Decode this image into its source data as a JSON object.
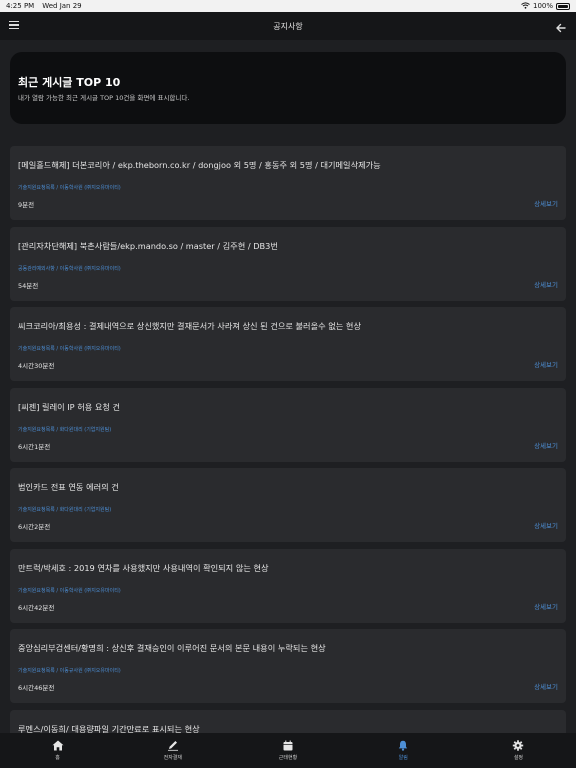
{
  "status_bar": {
    "time": "4:25 PM",
    "date": "Wed Jan 29",
    "battery": "100%"
  },
  "nav": {
    "title": "공지사항"
  },
  "banner": {
    "title": "최근 게시글 TOP 10",
    "subtitle": "내가 열람 가능한 최근 게시글 TOP 10건을 화면에 표시합니다."
  },
  "detail_label": "상세보기",
  "posts": [
    {
      "title": "[메일홀드해제] 더본코리아 / ekp.theborn.co.kr / dongjoo 외 5명 / 홍동주 외 5명 / 대기메일삭제가능",
      "category": "기술지원요청목록 / 이동학사원 (㈜지오유마이티)",
      "time": "9분전"
    },
    {
      "title": "[관리자차단해제] 북촌사람들/ekp.mando.so / master / 김주현 / DB3번",
      "category": "공동관리예외사항 / 이동학사원 (㈜지오유마이티)",
      "time": "54분전"
    },
    {
      "title": "씨크코리아/최용성 : 결제내역으로 상신했지만 결재문서가 사라져 상신 된 건으로 불러올수 없는 현상",
      "category": "기술지원요청목록 / 이동학사원 (㈜지오유마이티)",
      "time": "4시간30분전"
    },
    {
      "title": "[씨젠] 릴레이 IP 허용 요청 건",
      "category": "기술지원요청목록 / 화다윈대리 (기업지원팀)",
      "time": "6시간1분전"
    },
    {
      "title": "법인카드 전표 연동 에러의 건",
      "category": "기술지원요청목록 / 화다윈대리 (기업지원팀)",
      "time": "6시간2분전"
    },
    {
      "title": "만트럭/박세호 : 2019 연차를 사용했지만 사용내역이 확인되지 않는 현상",
      "category": "기술지원요청목록 / 이동학사원 (㈜지오유마이티)",
      "time": "6시간42분전"
    },
    {
      "title": "중앙심리부검센터/황명희 : 상신후 결재승인이 이루어진 문서의 본문 내용이 누락되는 현상",
      "category": "기술지원요청목록 / 이동규사원 (㈜지오유마이티)",
      "time": "6시간46분전"
    },
    {
      "title": "루멘스/이동희/ 대용량파일 기간만료로 표시되는 현상",
      "category": "",
      "time": ""
    }
  ],
  "tabs": [
    {
      "label": "홈",
      "icon": "home-icon"
    },
    {
      "label": "전자결재",
      "icon": "pencil-icon"
    },
    {
      "label": "근태현황",
      "icon": "calendar-icon"
    },
    {
      "label": "알림",
      "icon": "bell-icon",
      "active": true
    },
    {
      "label": "설정",
      "icon": "gear-icon"
    }
  ],
  "colors": {
    "background": "#1e1f22",
    "card": "#2a2b2e",
    "accent": "#4d8fd6",
    "bar": "#151618"
  }
}
